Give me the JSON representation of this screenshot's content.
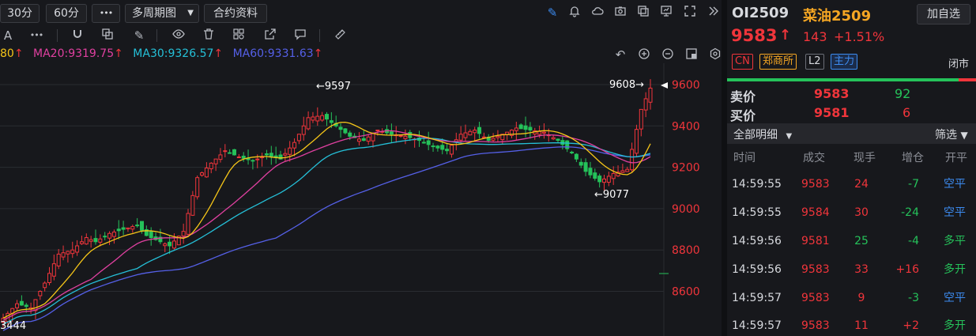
{
  "toolbar": {
    "period_30": "30分",
    "period_60": "60分",
    "more": "•••",
    "multi_period": "多周期图",
    "contract_info": "合约资料",
    "icons": [
      "pen-icon",
      "bell-icon",
      "cloud-icon",
      "camera-icon",
      "copy-icon",
      "monitor-icon",
      "expand-icon",
      "collapse-icon"
    ]
  },
  "drawing_toolbar": {
    "first": "A",
    "more": "•••",
    "icons": [
      "magnet-icon",
      "layers-icon",
      "pencil-icon",
      "eye-icon",
      "trash-icon",
      "shapes-icon",
      "export-icon",
      "comment-icon",
      "ruler-icon"
    ]
  },
  "ma": {
    "ma10_tail": "80",
    "ma20": "MA20:9319.75",
    "ma30": "MA30:9326.57",
    "ma60": "MA60:9331.63",
    "arrow": "↑",
    "colors": {
      "ma10": "#f5c518",
      "ma20": "#e040a0",
      "ma30": "#25c0d8",
      "ma60": "#5560e8"
    }
  },
  "chart_controls": [
    "undo-icon",
    "zoom-in-icon",
    "zoom-out-icon",
    "restore-icon",
    "settings-icon"
  ],
  "chart_data": {
    "type": "candlestick",
    "yticks": [
      "9600",
      "9400",
      "9200",
      "9000",
      "8800",
      "8600"
    ],
    "ylim": [
      8440,
      9640
    ],
    "annotations": {
      "high_label": "←9597",
      "high2_label": "9608→",
      "low_label": "←9077",
      "low2_label": "3444"
    },
    "last_price": 9583
  },
  "header": {
    "code": "OI2509",
    "name": "菜油2509",
    "add_watch": "加自选",
    "price": "9583",
    "price_arrow": "↑",
    "change": "143",
    "change_pct": "+1.51%",
    "tag_cn": "CN",
    "tag_exchange": "郑商所",
    "tag_l2": "L2",
    "tag_main": "主力",
    "status": "闭市"
  },
  "orderbook": {
    "sell_label": "卖价",
    "sell_price": "9583",
    "sell_vol": "92",
    "buy_label": "买价",
    "buy_price": "9581",
    "buy_vol": "6"
  },
  "ticks": {
    "filter_all": "全部明细",
    "filter": "筛选",
    "headers": [
      "时间",
      "成交",
      "现手",
      "增仓",
      "开平"
    ],
    "rows": [
      {
        "time": "14:59:55",
        "price": "9583",
        "vol": "24",
        "oi": "-7",
        "type": "空平"
      },
      {
        "time": "14:59:55",
        "price": "9584",
        "vol": "30",
        "oi": "-24",
        "type": "空平"
      },
      {
        "time": "14:59:56",
        "price": "9581",
        "vol": "25",
        "oi": "-4",
        "type": "多平"
      },
      {
        "time": "14:59:56",
        "price": "9583",
        "vol": "33",
        "oi": "+16",
        "type": "多开"
      },
      {
        "time": "14:59:57",
        "price": "9583",
        "vol": "9",
        "oi": "-3",
        "type": "空平"
      },
      {
        "time": "14:59:57",
        "price": "9583",
        "vol": "11",
        "oi": "+2",
        "type": "多开"
      }
    ]
  }
}
